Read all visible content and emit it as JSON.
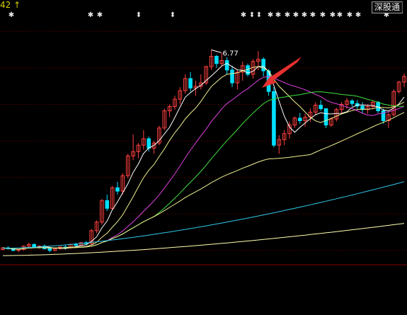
{
  "header": {
    "price_fragment": "42 ↑",
    "tab_label": "深股通",
    "events_glyph": "✱",
    "sep_glyph": "⬍"
  },
  "colors": {
    "background": "#000000",
    "up": "#ff4040",
    "down": "#00e0ff",
    "grid": "#7a0000",
    "arrow": "#e83030",
    "ma5": "#ffffff",
    "ma10": "#f0f090",
    "ma20": "#e040e0",
    "ma30": "#40e040",
    "ma60": "#f0f090",
    "ma120": "#30c8e8",
    "ma250": "#ffffb0"
  },
  "chart_data": {
    "type": "candlestick",
    "ylim": [
      1.8,
      7.6
    ],
    "high_annotation": "6.77",
    "gridlines": [
      7.2,
      6.35,
      5.5,
      4.65,
      3.8,
      2.95,
      2.1
    ],
    "candles": [
      [
        2.12,
        2.18,
        2.1,
        2.16
      ],
      [
        2.16,
        2.2,
        2.12,
        2.14
      ],
      [
        2.14,
        2.16,
        2.08,
        2.1
      ],
      [
        2.1,
        2.14,
        2.06,
        2.12
      ],
      [
        2.12,
        2.22,
        2.1,
        2.2
      ],
      [
        2.2,
        2.28,
        2.16,
        2.24
      ],
      [
        2.24,
        2.26,
        2.16,
        2.18
      ],
      [
        2.18,
        2.22,
        2.14,
        2.2
      ],
      [
        2.2,
        2.24,
        2.12,
        2.14
      ],
      [
        2.14,
        2.18,
        2.06,
        2.1
      ],
      [
        2.1,
        2.16,
        2.08,
        2.14
      ],
      [
        2.14,
        2.2,
        2.12,
        2.18
      ],
      [
        2.18,
        2.22,
        2.12,
        2.16
      ],
      [
        2.16,
        2.26,
        2.14,
        2.24
      ],
      [
        2.24,
        2.28,
        2.18,
        2.22
      ],
      [
        2.22,
        2.3,
        2.2,
        2.28
      ],
      [
        2.28,
        2.32,
        2.22,
        2.26
      ],
      [
        2.26,
        2.6,
        2.24,
        2.56
      ],
      [
        2.56,
        2.8,
        2.5,
        2.76
      ],
      [
        2.76,
        3.3,
        2.7,
        3.26
      ],
      [
        3.26,
        3.4,
        3.02,
        3.08
      ],
      [
        3.08,
        3.6,
        3.04,
        3.56
      ],
      [
        3.56,
        3.7,
        3.4,
        3.48
      ],
      [
        3.48,
        3.9,
        3.4,
        3.84
      ],
      [
        3.84,
        4.35,
        3.78,
        4.3
      ],
      [
        4.3,
        4.8,
        4.2,
        4.4
      ],
      [
        4.4,
        4.6,
        4.25,
        4.55
      ],
      [
        4.55,
        4.9,
        4.45,
        4.7
      ],
      [
        4.7,
        4.75,
        4.4,
        4.48
      ],
      [
        4.48,
        4.65,
        4.35,
        4.6
      ],
      [
        4.6,
        5.0,
        4.55,
        4.95
      ],
      [
        4.95,
        5.4,
        4.9,
        5.35
      ],
      [
        5.35,
        5.5,
        5.2,
        5.45
      ],
      [
        5.45,
        5.7,
        5.38,
        5.62
      ],
      [
        5.62,
        5.9,
        5.5,
        5.82
      ],
      [
        5.82,
        6.2,
        5.75,
        6.1
      ],
      [
        6.1,
        6.25,
        5.8,
        5.88
      ],
      [
        5.88,
        6.05,
        5.7,
        5.92
      ],
      [
        5.92,
        6.2,
        5.85,
        6.0
      ],
      [
        6.0,
        6.4,
        5.95,
        6.38
      ],
      [
        6.38,
        6.77,
        6.3,
        6.62
      ],
      [
        6.62,
        6.65,
        6.35,
        6.45
      ],
      [
        6.45,
        6.7,
        6.4,
        6.52
      ],
      [
        6.52,
        6.6,
        6.2,
        6.3
      ],
      [
        6.3,
        6.4,
        5.9,
        6.0
      ],
      [
        6.0,
        6.3,
        5.85,
        6.25
      ],
      [
        6.25,
        6.5,
        6.05,
        6.4
      ],
      [
        6.4,
        6.45,
        6.15,
        6.2
      ],
      [
        6.2,
        6.55,
        6.1,
        6.5
      ],
      [
        6.5,
        6.74,
        6.3,
        6.55
      ],
      [
        6.55,
        6.6,
        6.15,
        6.28
      ],
      [
        6.28,
        6.32,
        5.7,
        5.8
      ],
      [
        5.8,
        5.9,
        4.5,
        4.55
      ],
      [
        4.55,
        4.78,
        4.35,
        4.68
      ],
      [
        4.68,
        4.9,
        4.55,
        4.82
      ],
      [
        4.82,
        5.1,
        4.7,
        5.02
      ],
      [
        5.02,
        5.22,
        4.95,
        5.18
      ],
      [
        5.18,
        5.3,
        5.05,
        5.12
      ],
      [
        5.12,
        5.28,
        4.98,
        5.2
      ],
      [
        5.2,
        5.4,
        5.1,
        5.32
      ],
      [
        5.32,
        5.55,
        5.25,
        5.48
      ],
      [
        5.48,
        5.6,
        5.35,
        5.4
      ],
      [
        5.4,
        5.35,
        4.95,
        5.02
      ],
      [
        5.02,
        5.2,
        4.98,
        5.16
      ],
      [
        5.16,
        5.42,
        5.1,
        5.38
      ],
      [
        5.38,
        5.55,
        5.3,
        5.5
      ],
      [
        5.5,
        5.65,
        5.4,
        5.58
      ],
      [
        5.58,
        5.62,
        5.45,
        5.52
      ],
      [
        5.52,
        5.6,
        5.4,
        5.46
      ],
      [
        5.46,
        5.55,
        5.3,
        5.38
      ],
      [
        5.38,
        5.5,
        5.28,
        5.45
      ],
      [
        5.45,
        5.6,
        5.4,
        5.55
      ],
      [
        5.55,
        5.58,
        5.3,
        5.35
      ],
      [
        5.35,
        5.4,
        5.05,
        5.12
      ],
      [
        5.12,
        5.3,
        4.95,
        5.26
      ],
      [
        5.26,
        5.85,
        5.22,
        5.8
      ],
      [
        5.8,
        6.05,
        5.75,
        6.02
      ],
      [
        6.02,
        6.22,
        5.9,
        6.15
      ]
    ]
  }
}
